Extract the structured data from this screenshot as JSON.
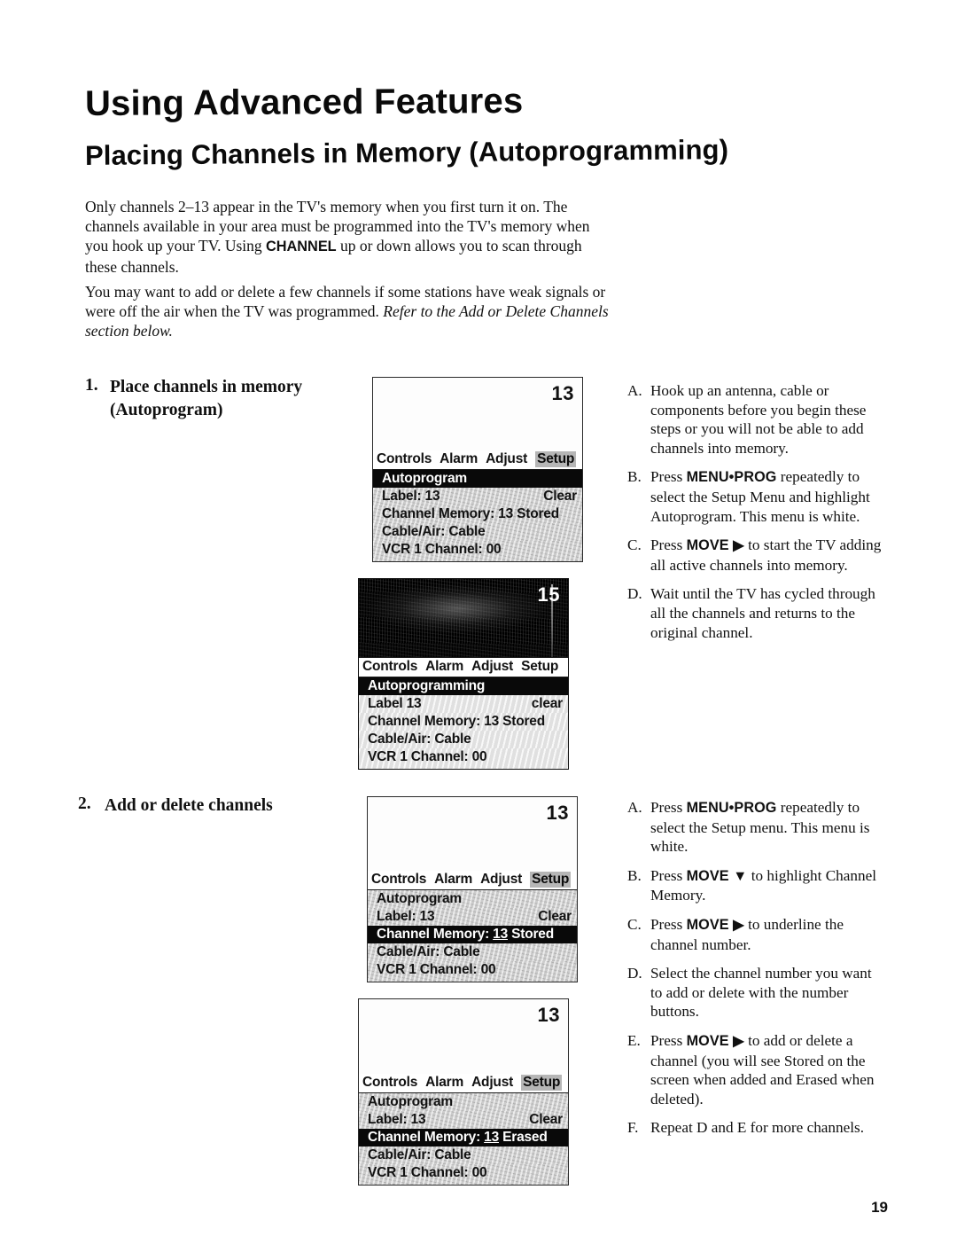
{
  "document": {
    "title": "Using Advanced Features",
    "subtitle": "Placing Channels in Memory (Autoprogramming)",
    "page_number": "19"
  },
  "intro": {
    "paragraph_1_part1": "Only channels 2–13 appear in the TV's memory when you first turn it on. The channels available in your area must be programmed into the TV's memory when you hook up your TV. Using ",
    "paragraph_1_bold": "CHANNEL",
    "paragraph_1_part2": " up or down allows you to scan through these channels.",
    "paragraph_2_part1": "You may want to add or delete a few channels if some stations have weak signals or were off the air when the TV was programmed. ",
    "paragraph_2_italic": "Refer to the Add or Delete Channels section below."
  },
  "steps": [
    {
      "number": "1.",
      "text": "Place channels in memory (Autoprogram)",
      "instructions": [
        {
          "letter": "A.",
          "part1": "Hook up an antenna, cable or components before you begin these steps or you will not be able to add channels into memory.",
          "bold": "",
          "part2": ""
        },
        {
          "letter": "B.",
          "part1": "Press ",
          "bold": "MENU•PROG",
          "part2": " repeatedly to select the Setup Menu and highlight Autoprogram. This menu is white."
        },
        {
          "letter": "C.",
          "part1": "Press ",
          "bold": "MOVE ▶",
          "part2": " to start the TV adding all active channels into memory."
        },
        {
          "letter": "D.",
          "part1": "Wait until the TV has cycled through all the channels and returns to the original channel.",
          "bold": "",
          "part2": ""
        }
      ]
    },
    {
      "number": "2.",
      "text": "Add or delete channels",
      "instructions": [
        {
          "letter": "A.",
          "part1": "Press ",
          "bold": "MENU•PROG",
          "part2": " repeatedly to select the Setup menu. This menu is white."
        },
        {
          "letter": "B.",
          "part1": "Press ",
          "bold": "MOVE ▼",
          "part2": " to highlight Channel Memory."
        },
        {
          "letter": "C.",
          "part1": "Press  ",
          "bold": "MOVE ▶",
          "part2": " to underline the channel number."
        },
        {
          "letter": "D.",
          "part1": "Select the channel number you want to add or delete with the number buttons.",
          "bold": "",
          "part2": ""
        },
        {
          "letter": "E.",
          "part1": "Press ",
          "bold": "MOVE ▶",
          "part2": " to add or delete a channel (you will see Stored on the screen when added and Erased when deleted)."
        },
        {
          "letter": "F.",
          "part1": "Repeat D and E for more channels.",
          "bold": "",
          "part2": ""
        }
      ]
    }
  ],
  "tv_screens": [
    {
      "id": "screen-1",
      "channel": "13",
      "background": "white",
      "menubar": [
        "Controls",
        "Alarm",
        "Adjust",
        "Setup"
      ],
      "menubar_highlight": "Setup",
      "rows": [
        {
          "left": "Autoprogram",
          "right": "",
          "state": "inverted"
        },
        {
          "left": "Label: 13",
          "right": "Clear",
          "state": "gray"
        },
        {
          "left": "Channel Memory: 13 Stored",
          "right": "",
          "state": "gray"
        },
        {
          "left": "Cable/Air: Cable",
          "right": "",
          "state": "gray"
        },
        {
          "left": "VCR 1 Channel: 00",
          "right": "",
          "state": "gray"
        }
      ]
    },
    {
      "id": "screen-2",
      "channel": "15",
      "background": "static",
      "menubar": [
        "Controls",
        "Alarm",
        "Adjust",
        "Setup"
      ],
      "menubar_highlight": "",
      "rows": [
        {
          "left": "Autoprogramming",
          "right": "",
          "state": "inverted"
        },
        {
          "left": "Label  13",
          "right": "clear",
          "state": "light"
        },
        {
          "left": "Channel Memory: 13 Stored",
          "right": "",
          "state": "light"
        },
        {
          "left": "Cable/Air: Cable",
          "right": "",
          "state": "light"
        },
        {
          "left": "VCR 1 Channel: 00",
          "right": "",
          "state": "light"
        }
      ]
    },
    {
      "id": "screen-3",
      "channel": "13",
      "background": "white",
      "menubar": [
        "Controls",
        "Alarm",
        "Adjust",
        "Setup"
      ],
      "menubar_highlight": "Setup",
      "rows": [
        {
          "left": "Autoprogram",
          "right": "",
          "state": "gray"
        },
        {
          "left": "Label: 13",
          "right": "Clear",
          "state": "gray"
        },
        {
          "left": "Channel Memory: 13 Stored",
          "right": "",
          "state": "inverted",
          "underline": "13"
        },
        {
          "left": "Cable/Air: Cable",
          "right": "",
          "state": "gray"
        },
        {
          "left": "VCR 1 Channel: 00",
          "right": "",
          "state": "gray"
        }
      ]
    },
    {
      "id": "screen-4",
      "channel": "13",
      "background": "white",
      "menubar": [
        "Controls",
        "Alarm",
        "Adjust",
        "Setup"
      ],
      "menubar_highlight": "Setup",
      "rows": [
        {
          "left": "Autoprogram",
          "right": "",
          "state": "gray"
        },
        {
          "left": "Label: 13",
          "right": "Clear",
          "state": "gray"
        },
        {
          "left": "Channel Memory: 13 Erased",
          "right": "",
          "state": "inverted",
          "underline": "13"
        },
        {
          "left": "Cable/Air: Cable",
          "right": "",
          "state": "gray"
        },
        {
          "left": "VCR 1 Channel: 00",
          "right": "",
          "state": "gray"
        }
      ]
    }
  ]
}
